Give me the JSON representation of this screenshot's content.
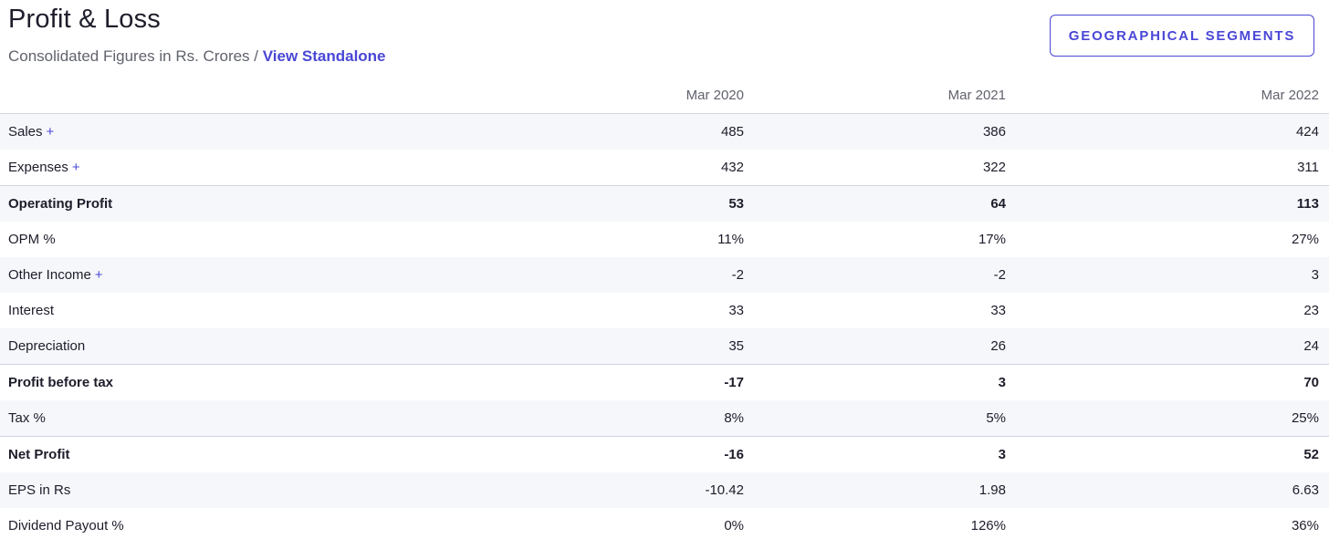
{
  "header": {
    "title": "Profit & Loss",
    "subtitle_prefix": "Consolidated Figures in Rs. Crores / ",
    "subtitle_link": "View Standalone"
  },
  "segments_button": {
    "label": "GEOGRAPHICAL SEGMENTS"
  },
  "colors": {
    "accent": "#4a47d6",
    "row_alt": "#f6f7fb",
    "text": "#1d1d2b",
    "muted": "#60636d"
  },
  "table": {
    "columns": [
      "Mar 2020",
      "Mar 2021",
      "Mar 2022"
    ],
    "rows": [
      {
        "label": "Sales",
        "expandable": true,
        "strong": false,
        "alt": true,
        "values": [
          "485",
          "386",
          "424"
        ]
      },
      {
        "label": "Expenses",
        "expandable": true,
        "strong": false,
        "alt": false,
        "values": [
          "432",
          "322",
          "311"
        ]
      },
      {
        "label": "Operating Profit",
        "expandable": false,
        "strong": true,
        "alt": true,
        "values": [
          "53",
          "64",
          "113"
        ]
      },
      {
        "label": "OPM %",
        "expandable": false,
        "strong": false,
        "alt": false,
        "values": [
          "11%",
          "17%",
          "27%"
        ]
      },
      {
        "label": "Other Income",
        "expandable": true,
        "strong": false,
        "alt": true,
        "values": [
          "-2",
          "-2",
          "3"
        ]
      },
      {
        "label": "Interest",
        "expandable": false,
        "strong": false,
        "alt": false,
        "values": [
          "33",
          "33",
          "23"
        ]
      },
      {
        "label": "Depreciation",
        "expandable": false,
        "strong": false,
        "alt": true,
        "values": [
          "35",
          "26",
          "24"
        ]
      },
      {
        "label": "Profit before tax",
        "expandable": false,
        "strong": true,
        "alt": false,
        "values": [
          "-17",
          "3",
          "70"
        ]
      },
      {
        "label": "Tax %",
        "expandable": false,
        "strong": false,
        "alt": true,
        "values": [
          "8%",
          "5%",
          "25%"
        ]
      },
      {
        "label": "Net Profit",
        "expandable": false,
        "strong": true,
        "alt": false,
        "values": [
          "-16",
          "3",
          "52"
        ]
      },
      {
        "label": "EPS in Rs",
        "expandable": false,
        "strong": false,
        "alt": true,
        "values": [
          "-10.42",
          "1.98",
          "6.63"
        ]
      },
      {
        "label": "Dividend Payout %",
        "expandable": false,
        "strong": false,
        "alt": false,
        "values": [
          "0%",
          "126%",
          "36%"
        ]
      }
    ],
    "expand_symbol": "+"
  }
}
